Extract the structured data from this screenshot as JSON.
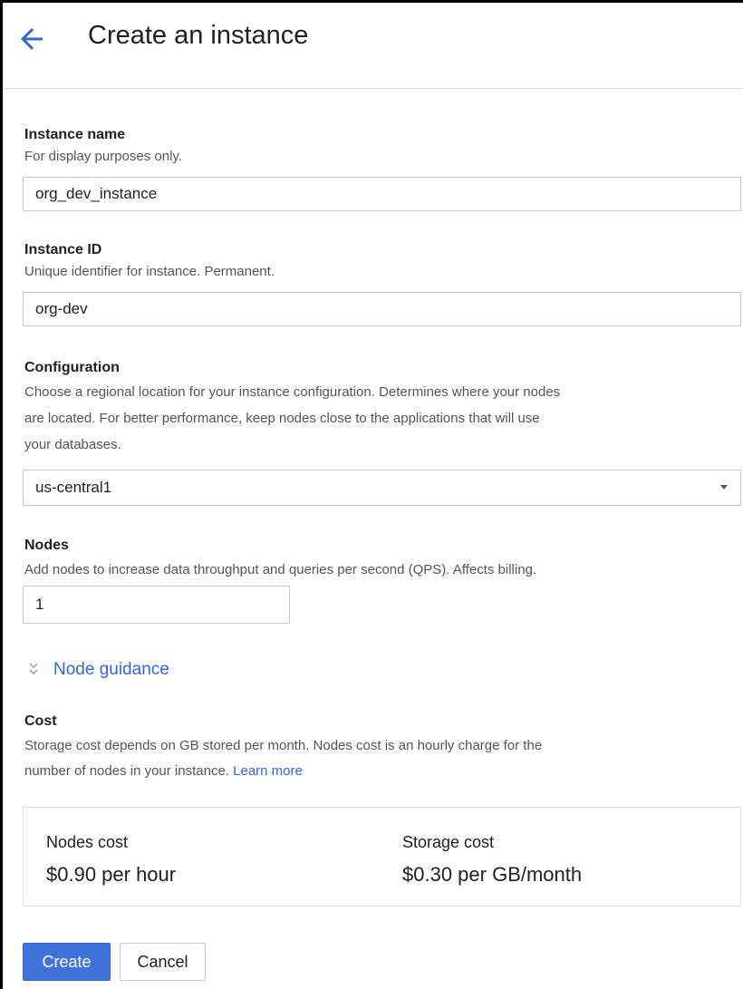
{
  "header": {
    "title": "Create an instance"
  },
  "instance_name": {
    "label": "Instance name",
    "help": "For display purposes only.",
    "value": "org_dev_instance"
  },
  "instance_id": {
    "label": "Instance ID",
    "help": "Unique identifier for instance. Permanent.",
    "value": "org-dev"
  },
  "configuration": {
    "label": "Configuration",
    "help_line1": "Choose a regional location for your instance configuration. Determines where your nodes",
    "help_line2": "are located. For better performance, keep nodes close to the applications that will use",
    "help_line3": "your databases.",
    "selected": "us-central1"
  },
  "nodes": {
    "label": "Nodes",
    "help": "Add nodes to increase data throughput and queries per second (QPS). Affects billing.",
    "value": "1"
  },
  "node_guidance": {
    "label": "Node guidance"
  },
  "cost": {
    "label": "Cost",
    "help_line1": "Storage cost depends on GB stored per month. Nodes cost is an hourly charge for the",
    "help_line2_prefix": "number of nodes in your instance.",
    "learn_more": "Learn more",
    "nodes_cost_label": "Nodes cost",
    "nodes_cost_value": "$0.90 per hour",
    "storage_cost_label": "Storage cost",
    "storage_cost_value": "$0.30 per GB/month"
  },
  "actions": {
    "create": "Create",
    "cancel": "Cancel"
  },
  "icons": {
    "back": "back-arrow-icon",
    "dropdown": "caret-down-icon",
    "guidance": "double-chevron-down-icon"
  },
  "colors": {
    "accent": "#3367d6",
    "primary_button": "#3f73d9"
  }
}
